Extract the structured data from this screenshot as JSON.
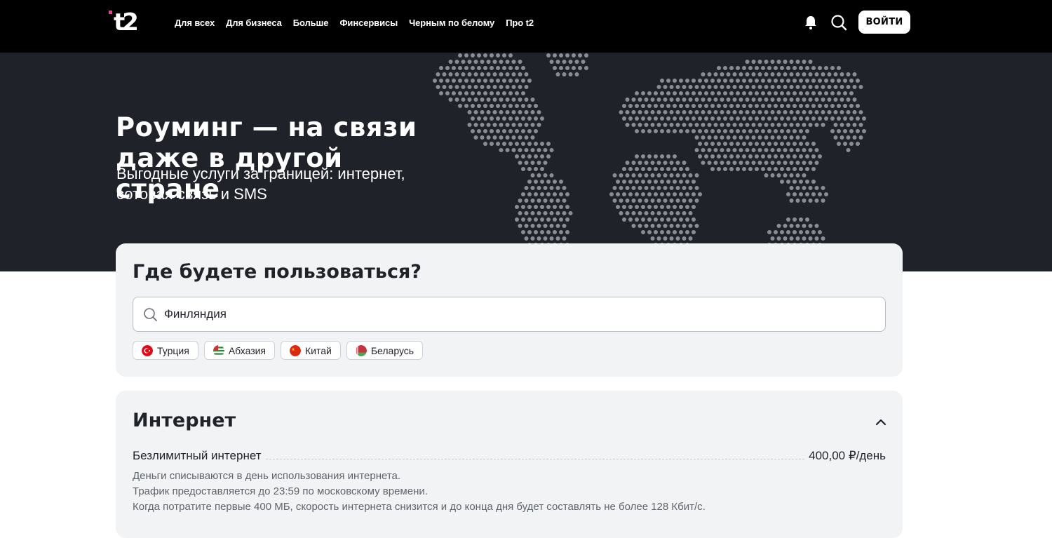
{
  "header": {
    "nav": [
      "Для всех",
      "Для бизнеса",
      "Больше",
      "Финсервисы",
      "Черным по белому",
      "Про t2"
    ],
    "login_label": "ВОЙТИ",
    "icons": {
      "logo": "t2-logo",
      "bell": "bell-icon",
      "search": "search-icon"
    }
  },
  "hero": {
    "title_lines": [
      "Роуминг — на связи",
      "даже в другой",
      "стране"
    ],
    "subtitle_lines": [
      "Выгодные услуги за границей: интернет,",
      "сотовая связь и SMS"
    ]
  },
  "search_card": {
    "title": "Где будете пользоваться?",
    "input_value": "Финляндия",
    "chips": [
      {
        "label": "Турция",
        "flag": "turkey-flag-icon"
      },
      {
        "label": "Абхазия",
        "flag": "abkhazia-flag-icon"
      },
      {
        "label": "Китай",
        "flag": "china-flag-icon"
      },
      {
        "label": "Беларусь",
        "flag": "belarus-flag-icon"
      }
    ]
  },
  "internet_card": {
    "title": "Интернет",
    "item_name": "Безлимитный интернет",
    "item_price": "400,00 ₽/день",
    "description": [
      "Деньги списываются в день использования интернета.",
      "Трафик предоставляется до 23:59 по московскому времени.",
      "Когда потратите первые 400 МБ, скорость интернета снизится и до конца дня будет составлять не более 128 Кбит/с."
    ]
  },
  "colors": {
    "header_bg": "#000000",
    "hero_bg": "#1f2229",
    "card_bg": "#f2f3f5",
    "accent": "#ff3495",
    "map_dots": "#8a8d93"
  }
}
